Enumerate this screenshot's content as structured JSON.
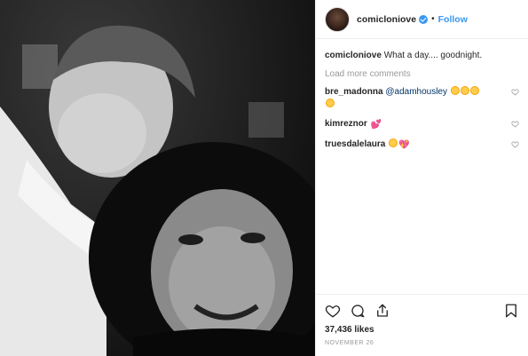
{
  "header": {
    "username": "comicloniove",
    "separator": "•",
    "follow_label": "Follow"
  },
  "caption": {
    "username": "comicloniove",
    "text": "What a day.... goodnight."
  },
  "load_more_label": "Load more comments",
  "comments": [
    {
      "username": "bre_madonna",
      "mention": "@adamhousley",
      "emojis": [
        "crying-face",
        "crying-face",
        "crying-face",
        "crying-face"
      ]
    },
    {
      "username": "kimreznor",
      "emojis": [
        "sparkling-heart"
      ]
    },
    {
      "username": "truesdalelaura",
      "emojis": [
        "heart-eyes-face",
        "sparkling-heart"
      ]
    }
  ],
  "likes": "37,436 likes",
  "date": "NOVEMBER 26",
  "icons": [
    "heart-icon",
    "comment-icon",
    "share-icon",
    "bookmark-icon",
    "verified-badge-icon"
  ],
  "colors": {
    "link": "#3897f0",
    "text": "#262626",
    "muted": "#999999"
  }
}
